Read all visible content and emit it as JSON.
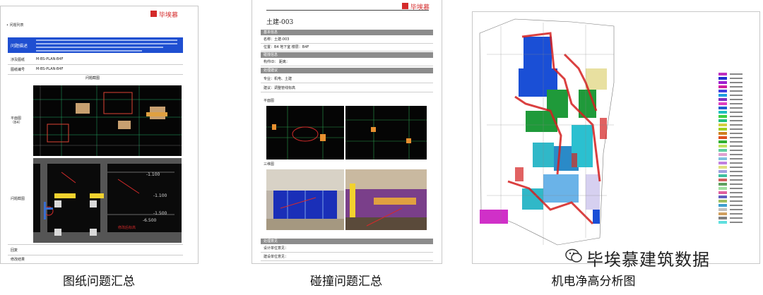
{
  "panels": {
    "left": {
      "caption": "图纸问题汇总",
      "logo_text": "毕埃慕",
      "header_text": "问题描述",
      "labels": [
        "问题描述",
        "涉及图纸",
        "图纸编号",
        "平面图",
        "问题截图",
        "回复",
        "修改结果"
      ],
      "codes": [
        "M-BS-PLAN-B4F",
        "M-BS-PLAN-B4F"
      ],
      "dims": [
        "-1.100",
        "-1.100",
        "-1.500",
        "-6.500"
      ]
    },
    "middle": {
      "caption": "碰撞问题汇总",
      "logo_text": "毕埃慕",
      "title": "土建-003",
      "section1": "基本信息",
      "section2": "碰撞信息",
      "section3": "处理建议",
      "section4": "平面图",
      "section5": "三维图",
      "section6": "处理意见"
    },
    "right": {
      "caption": "机电净高分析图"
    }
  },
  "watermark": {
    "text": "毕埃慕建筑数据"
  },
  "colors": {
    "blue_header": "#1f4fd1",
    "gray_header": "#8c8c8c",
    "cad_bg": "#050505",
    "accent_red": "#d41f1f"
  }
}
